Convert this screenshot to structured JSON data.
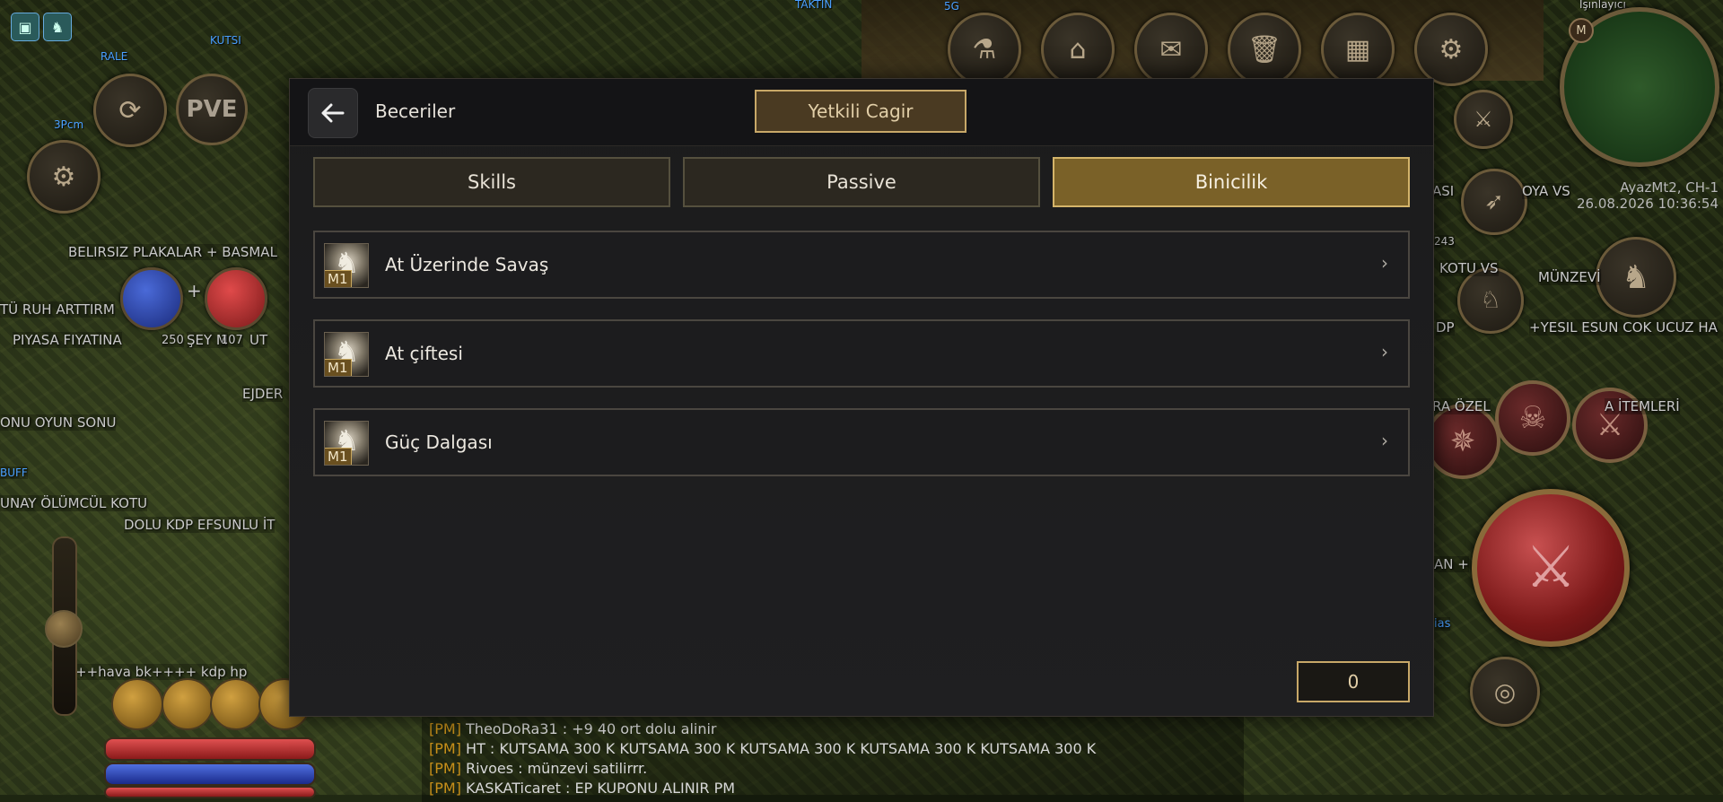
{
  "background": {
    "name_tags": [
      "RALE",
      "KUTSI",
      "3Pcm",
      "TAKTIN",
      "5G",
      "Işınlayıcı"
    ],
    "overlay_texts": [
      "BELIRSIZ PLAKALAR + BASMAL",
      "TÜ RUH ARTTIRM",
      "PIYASA FIYATINA",
      "ŞEY M",
      "UT",
      "EJDER",
      "ONU OYUN SONU",
      "BUFF",
      "UNAY ÖLÜMCÜL KOTU",
      "DOLU KDP EFSUNLU İT",
      "++hava bk++++ kdp hp",
      "ASI",
      "OYA VS",
      "KOTU VS",
      "MÜNZEVİ",
      "DP",
      "+YESIL ESUN COK UCUZ HA",
      "RA ÖZEL",
      "A İTEMLERİ",
      "AN +",
      "ias"
    ],
    "server_name": "AyazMt2, CH-1",
    "server_time": "26.08.2026 10:36:54",
    "pve_label": "PVE",
    "minimap_label": "M",
    "number_badge": "243",
    "potion_count_left": "250",
    "potion_count_right": "107",
    "chat": [
      {
        "tag": "[PM]",
        "text": "TheoDoRa31 : +9 40 ort dolu alinir"
      },
      {
        "tag": "[PM]",
        "text": "HT : KUTSAMA 300 K KUTSAMA 300 K KUTSAMA 300 K KUTSAMA 300 K KUTSAMA 300 K"
      },
      {
        "tag": "[PM]",
        "text": "Rivoes : münzevi satilirrr."
      },
      {
        "tag": "[PM]",
        "text": "KASKATicaret : EP KUPONU ALINIR PM"
      }
    ]
  },
  "dialog": {
    "title": "Beceriler",
    "gm_button": "Yetkili Cagir",
    "tabs": [
      {
        "label": "Skills",
        "active": false
      },
      {
        "label": "Passive",
        "active": false
      },
      {
        "label": "Binicilik",
        "active": true
      }
    ],
    "skills": [
      {
        "name": "At Üzerinde Savaş",
        "level": "M1",
        "icon": "horse-charge-icon"
      },
      {
        "name": "At çiftesi",
        "level": "M1",
        "icon": "horse-kick-icon"
      },
      {
        "name": "Güç Dalgası",
        "level": "M1",
        "icon": "power-wave-icon"
      }
    ],
    "skill_points": "0"
  },
  "colors": {
    "active_tab": "#7a6128",
    "gold_border": "#c8a868",
    "dialog_bg": "#1e1e20"
  }
}
